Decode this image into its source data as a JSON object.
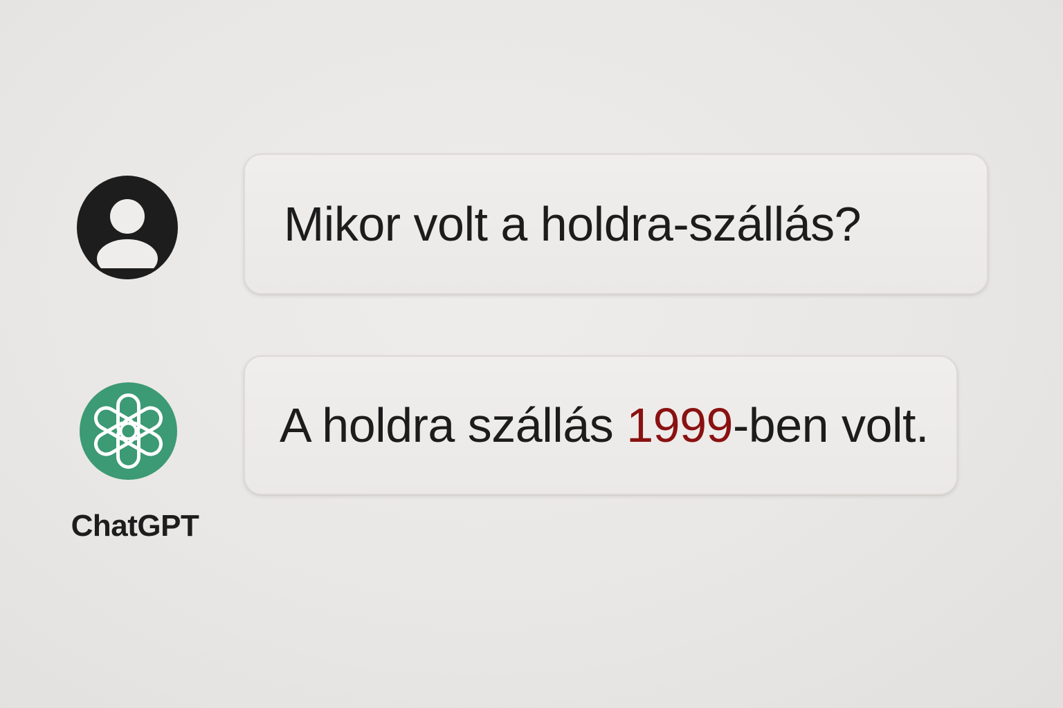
{
  "conversation": {
    "user_message": {
      "avatar_icon": "user-icon",
      "text": "Mikor volt a holdra-szállás?"
    },
    "assistant_message": {
      "avatar_icon": "openai-logo-icon",
      "label": "ChatGPT",
      "text_before": "A holdra szállás ",
      "highlight": "1999",
      "text_after": "-ben volt."
    }
  },
  "colors": {
    "background": "#ebe9e7",
    "bubble": "#eeecea",
    "text": "#1c1c1c",
    "highlight": "#8a1111",
    "user_avatar": "#1d1d1d",
    "assistant_avatar": "#3c9a74"
  }
}
